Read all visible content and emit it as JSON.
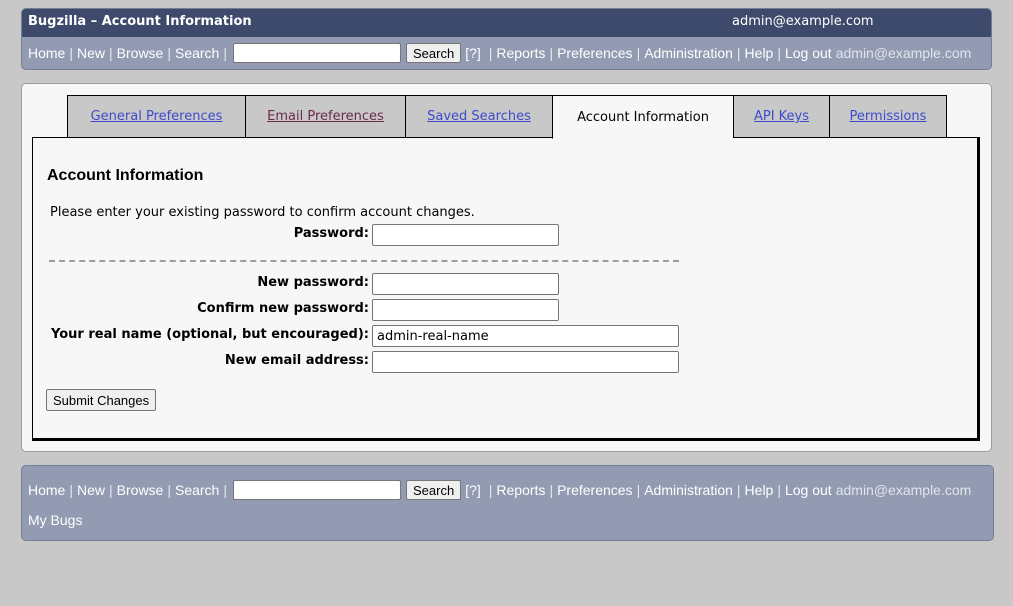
{
  "header": {
    "title": "Bugzilla – Account Information",
    "user": "admin@example.com"
  },
  "nav": {
    "home": "Home",
    "new": "New",
    "browse": "Browse",
    "search": "Search",
    "search_button": "Search",
    "help_marker": "[?]",
    "reports": "Reports",
    "preferences": "Preferences",
    "administration": "Administration",
    "help": "Help",
    "logout": "Log out",
    "login_name": "admin@example.com",
    "separator": "|"
  },
  "tabs": [
    {
      "label": "General Preferences"
    },
    {
      "label": "Email Preferences"
    },
    {
      "label": "Saved Searches"
    },
    {
      "label": "Account Information"
    },
    {
      "label": "API Keys"
    },
    {
      "label": "Permissions"
    }
  ],
  "form": {
    "heading": "Account Information",
    "intro": "Please enter your existing password to confirm account changes.",
    "password_label": "Password:",
    "new_password_label": "New password:",
    "confirm_password_label": "Confirm new password:",
    "real_name_label": "Your real name (optional, but encouraged):",
    "real_name_value": "admin-real-name",
    "new_email_label": "New email address:",
    "submit_label": "Submit Changes"
  },
  "footer": {
    "my_bugs": "My Bugs"
  },
  "colors": {
    "title_bar": "#3d4a6b",
    "nav_bar": "#929bb1",
    "link": "#3c4bcb",
    "visited_link": "#6b2a4d",
    "page_bg": "#c8c8c8"
  }
}
